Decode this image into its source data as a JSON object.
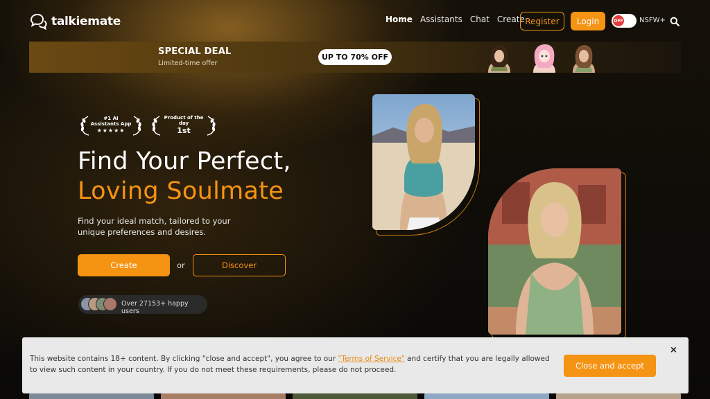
{
  "header": {
    "logo_text": "talkiemate",
    "nav": [
      "Home",
      "Assistants",
      "Chat",
      "Create"
    ],
    "active_nav": "Home",
    "register_label": "Register",
    "login_label": "Login",
    "nsfw_toggle_state": "OFF",
    "nsfw_label": "NSFW+"
  },
  "deal": {
    "title": "SPECIAL DEAL",
    "subtitle": "Limited-time offer",
    "badge": "UP TO 70% OFF"
  },
  "hero": {
    "award1_line1": "#1 AI Assistants App",
    "award1_line2": "★★★★★",
    "award2_line1": "Product of the day",
    "award2_line2": "1st",
    "title_line1": "Find Your Perfect,",
    "title_line2": "Loving Soulmate",
    "description": "Find your ideal match, tailored to your unique preferences and desires.",
    "create_label": "Create",
    "or_label": "or",
    "discover_label": "Discover",
    "users_text": "Over 27153+ happy users"
  },
  "consent": {
    "text_before": "This website contains 18+ content. By clicking \"close and accept\", you agree to our ",
    "tos_link": "\"Terms of Service\"",
    "text_after": " and certify that you are legally allowed to view such content in your country. If you do not meet these requirements, please do not proceed.",
    "accept_label": "Close and accept",
    "close_symbol": "×"
  },
  "colors": {
    "accent": "#f59313",
    "background": "#0b0b0b",
    "consent_bg": "#e9e9e9",
    "toggle_off": "#e53a3a"
  }
}
